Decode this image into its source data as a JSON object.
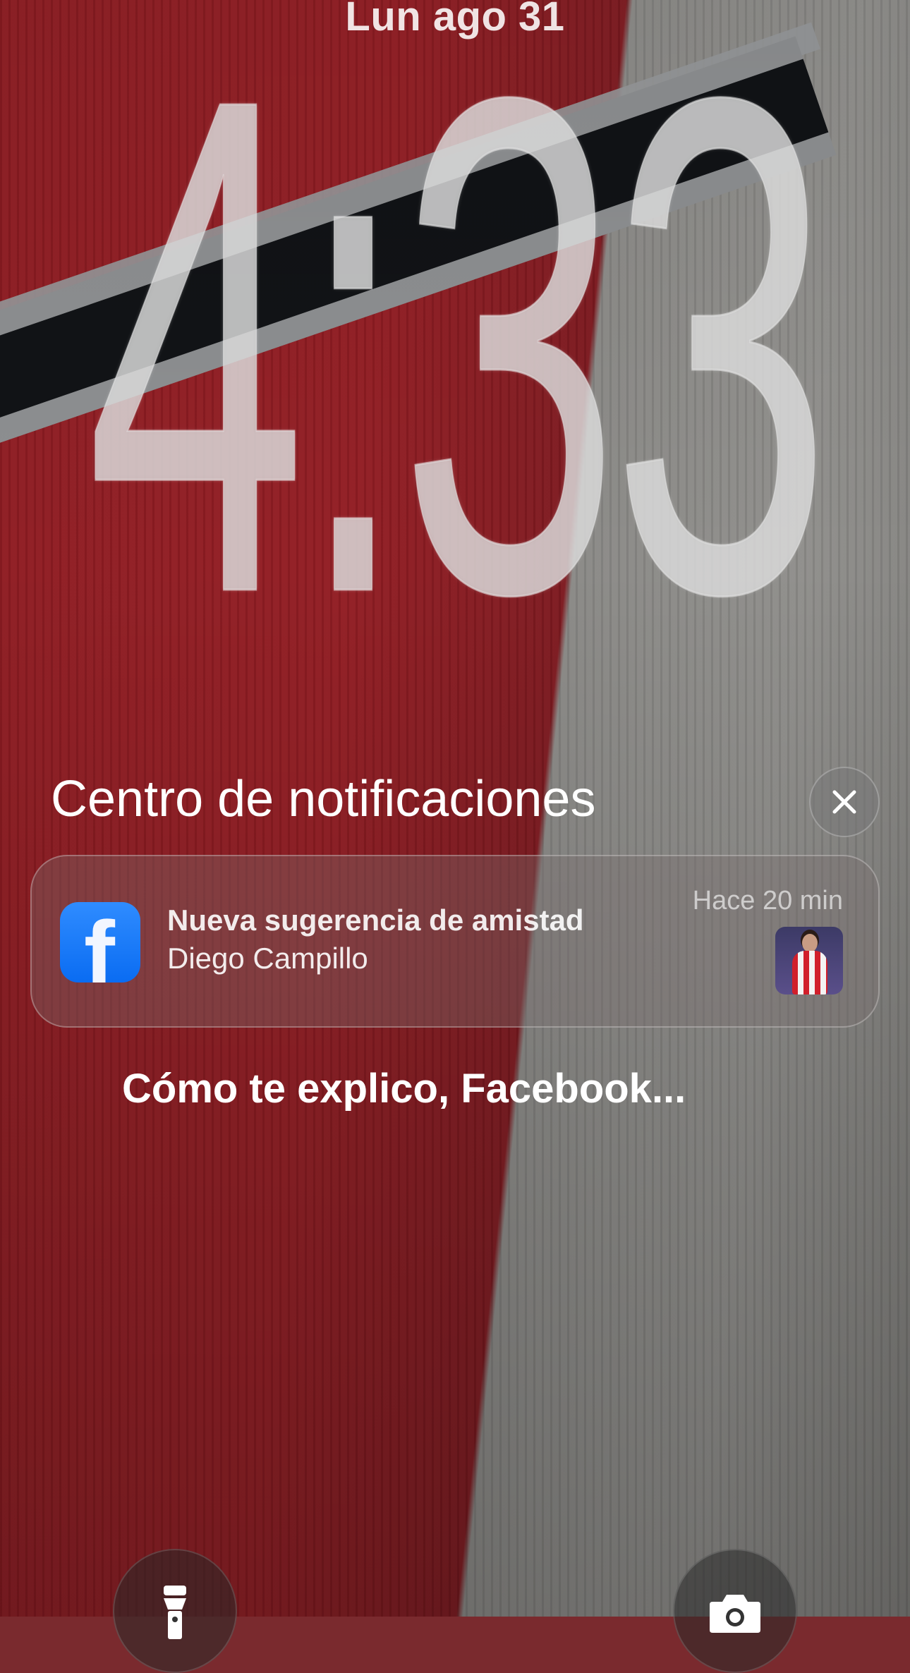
{
  "lock_screen": {
    "date": "Lun ago 31",
    "time": "4:33"
  },
  "notification_center": {
    "title": "Centro de notificaciones",
    "close_glyph": "✕"
  },
  "notification": {
    "app_icon": "facebook-icon",
    "app_icon_glyph": "f",
    "title": "Nueva sugerencia de amistad",
    "body": "Diego Campillo",
    "time": "Hace 20 min",
    "thumbnail": "profile-photo"
  },
  "caption": "Cómo te explico, Facebook...",
  "quick_actions": {
    "flashlight_icon": "flashlight-icon",
    "camera_icon": "camera-icon"
  },
  "colors": {
    "facebook_blue": "#0a6cf2",
    "wallpaper_red": "#921d23",
    "wallpaper_gray": "#8f8e8b"
  }
}
